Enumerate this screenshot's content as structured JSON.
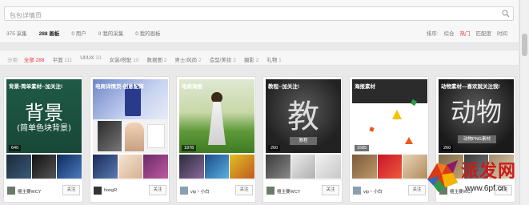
{
  "search": {
    "placeholder": "包包详情页"
  },
  "tabs": [
    {
      "count": "375",
      "label": "采集"
    },
    {
      "count": "288",
      "label": "画板"
    },
    {
      "count": "0",
      "label": "用户"
    },
    {
      "count": "0",
      "label": "我的采集"
    },
    {
      "count": "0",
      "label": "我的画板"
    }
  ],
  "sort": {
    "label": "排序:",
    "options": [
      "综合",
      "热门",
      "匹配度",
      "时间"
    ],
    "active": "热门"
  },
  "categories": {
    "label": "分类:",
    "items": [
      {
        "name": "全部",
        "count": "288"
      },
      {
        "name": "平面",
        "count": "111"
      },
      {
        "name": "UI/UX",
        "count": "33"
      },
      {
        "name": "女装/搭配",
        "count": "10"
      },
      {
        "name": "数据图",
        "count": "2"
      },
      {
        "name": "男士/风尚",
        "count": "2"
      },
      {
        "name": "造型/美妆",
        "count": "2"
      },
      {
        "name": "摄影",
        "count": "2"
      },
      {
        "name": "礼物",
        "count": "1"
      }
    ]
  },
  "cards": [
    {
      "title": "背景-简单素材--加关注!",
      "big_text": "背景",
      "sub_text": "(简单色块背景)",
      "count": "640",
      "user": "檀主要WCY",
      "follow": "关注"
    },
    {
      "title": "电商详情页-创意配饰",
      "count": "",
      "user": "hongR",
      "follow": "关注"
    },
    {
      "title": "电商海报",
      "count": "1978",
      "user": "vip丶小白",
      "follow": "关注"
    },
    {
      "title": "教程--加关注!",
      "big_text": "教",
      "tag": "教程",
      "count": "260",
      "user": "檀主要WCY",
      "follow": "关注"
    },
    {
      "title": "海报素材",
      "count": "1585",
      "user": "vip丶小白",
      "follow": "关注"
    },
    {
      "title": "动物素材—喜欢就关注我!",
      "big_text": "动物",
      "tag": "动物PNG素材",
      "count": "260",
      "user": "檀主要WCY",
      "follow": "关注"
    }
  ],
  "watermark": {
    "brand": "派发网",
    "url": "www.6pf.cn"
  },
  "colors": {
    "accent": "#e4393c",
    "brand_red": "#cc1a1a",
    "tag_orange": "#e85a1a"
  }
}
